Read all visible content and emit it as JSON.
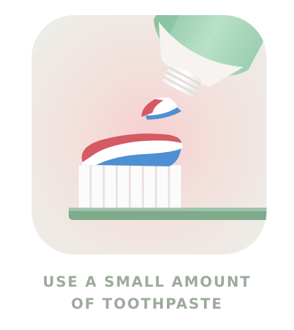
{
  "caption": {
    "line1": "USE A SMALL AMOUNT",
    "line2": "OF TOOTHPASTE"
  },
  "icons": [
    "toothpaste-tube-icon",
    "toothbrush-icon",
    "toothpaste-ribbon-icon"
  ],
  "colors": {
    "background_tile": "#efece7",
    "glow": "#f8d9d9",
    "tube_green": "#a8d6bb",
    "brush_handle": "#7fab8c",
    "paste_red": "#d45a63",
    "paste_blue": "#4f8fd3",
    "caption_text": "#9eab9c"
  }
}
